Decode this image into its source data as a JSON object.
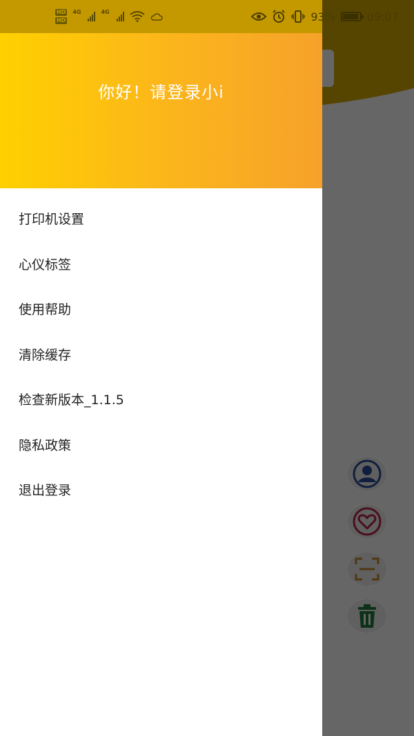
{
  "status_bar": {
    "hd_labels": [
      "HD",
      "HD"
    ],
    "network_1": "4G",
    "network_2": "4G",
    "battery_text": "93%",
    "battery_level": 0.93,
    "time": "09:07"
  },
  "drawer": {
    "greeting": "你好！请登录小i",
    "menu_items": [
      {
        "label": "打印机设置"
      },
      {
        "label": "心仪标签"
      },
      {
        "label": "使用帮助"
      },
      {
        "label": "清除缓存"
      },
      {
        "label": "检查新版本_1.1.5"
      },
      {
        "label": "隐私政策"
      },
      {
        "label": "退出登录"
      }
    ]
  },
  "fabs": [
    {
      "icon": "user-icon",
      "color": "#2b4e9b"
    },
    {
      "icon": "heart-icon",
      "color": "#b8264a"
    },
    {
      "icon": "scan-icon",
      "color": "#c98a2b"
    },
    {
      "icon": "trash-icon",
      "color": "#1e7a3a"
    }
  ],
  "colors": {
    "header_gradient_start": "#ffd000",
    "header_gradient_end": "#f6a22a",
    "scrim": "rgba(0,0,0,0.6)"
  }
}
